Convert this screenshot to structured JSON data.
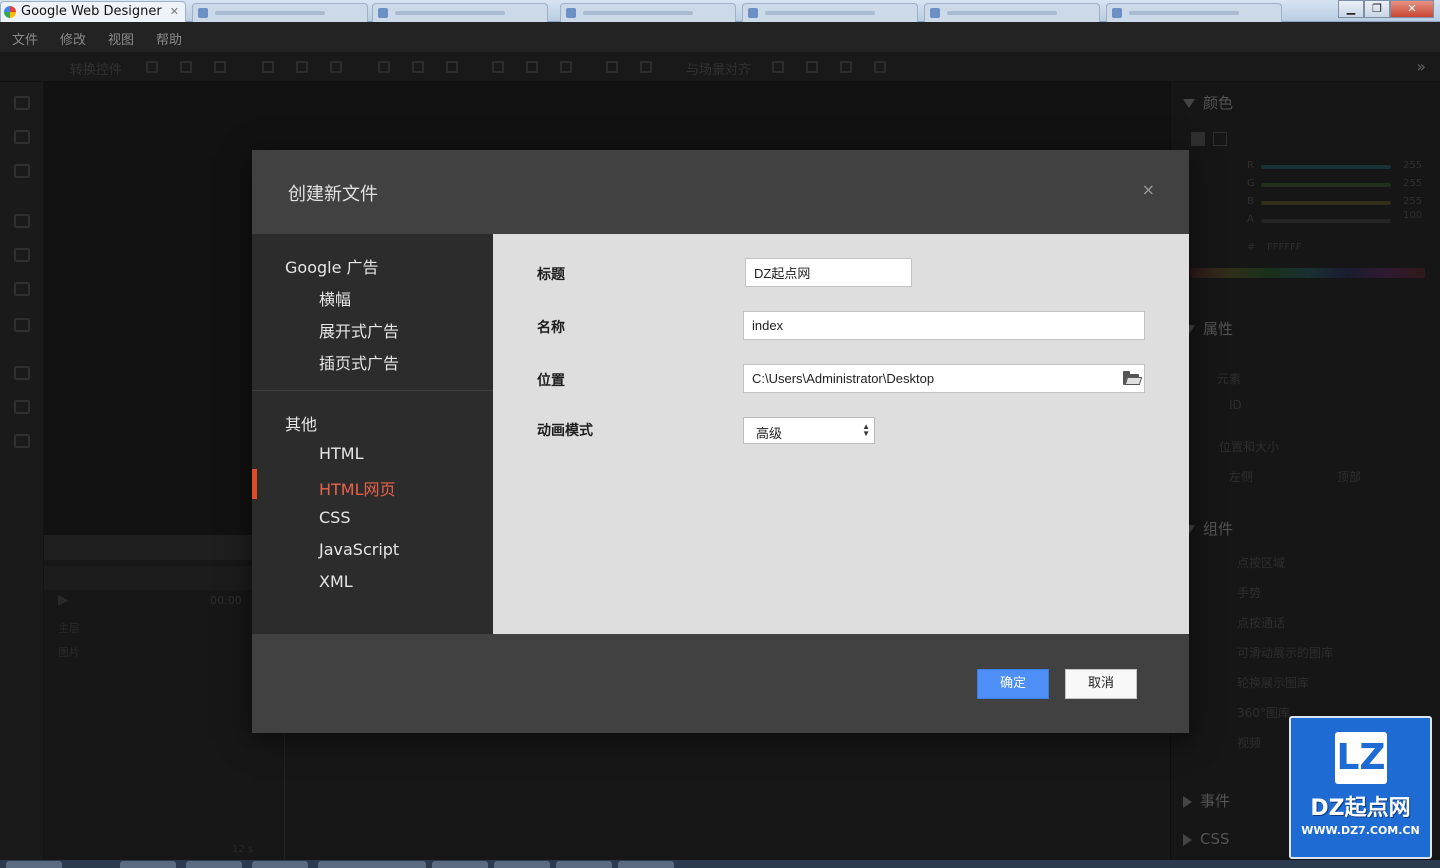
{
  "window": {
    "app_title": "Google Web Designer",
    "controls": {
      "minimize": "▁",
      "maximize": "❐",
      "close": "✕"
    }
  },
  "menubar": {
    "items": [
      "文件",
      "修改",
      "视图",
      "帮助"
    ]
  },
  "toolbar": {
    "convert_label": "转换控件",
    "align_label": "与场景对齐",
    "more": "»"
  },
  "right_panel": {
    "color_title": "颜色",
    "channels": [
      {
        "name": "R",
        "value": "255",
        "color": "#1e3f3f"
      },
      {
        "name": "G",
        "value": "255",
        "color": "#2a3a22"
      },
      {
        "name": "B",
        "value": "255",
        "color": "#3b3b1f"
      },
      {
        "name": "A",
        "value": "100",
        "color": "#2c2c2c"
      }
    ],
    "hex_label": "#",
    "hex_value": "FFFFFF",
    "properties_title": "属性",
    "element_label": "元素",
    "id_label": "ID",
    "position_size_label": "位置和大小",
    "left_label": "左侧",
    "top_label": "顶部",
    "components_title": "组件",
    "components": [
      "点按区域",
      "手势",
      "点按通话",
      "可滑动展示的图库",
      "轮换展示图库",
      "360°图库",
      "视频"
    ],
    "events_title": "事件",
    "css_title": "CSS"
  },
  "timeline": {
    "time": "00:00",
    "layer1": "主层",
    "layer2": "图片",
    "fps": "12 s"
  },
  "dialog": {
    "title": "创建新文件",
    "close": "×",
    "groups": [
      {
        "label": "Google 广告",
        "items": [
          "横幅",
          "展开式广告",
          "插页式广告"
        ]
      },
      {
        "label": "其他",
        "items": [
          "HTML",
          "HTML网页",
          "CSS",
          "JavaScript",
          "XML"
        ]
      }
    ],
    "selected_item": "HTML网页",
    "form": {
      "title_label": "标题",
      "title_value": "DZ起点网",
      "name_label": "名称",
      "name_value": "index",
      "location_label": "位置",
      "location_value": "C:\\Users\\Administrator\\Desktop",
      "animation_label": "动画模式",
      "animation_value": "高级"
    },
    "ok_label": "确定",
    "cancel_label": "取消",
    "accent_color": "#dd4b2b",
    "ok_color": "#4d8ef7"
  },
  "watermark": {
    "logo": "LZ",
    "name": "DZ起点网",
    "url": "WWW.DZ7.COM.CN"
  }
}
